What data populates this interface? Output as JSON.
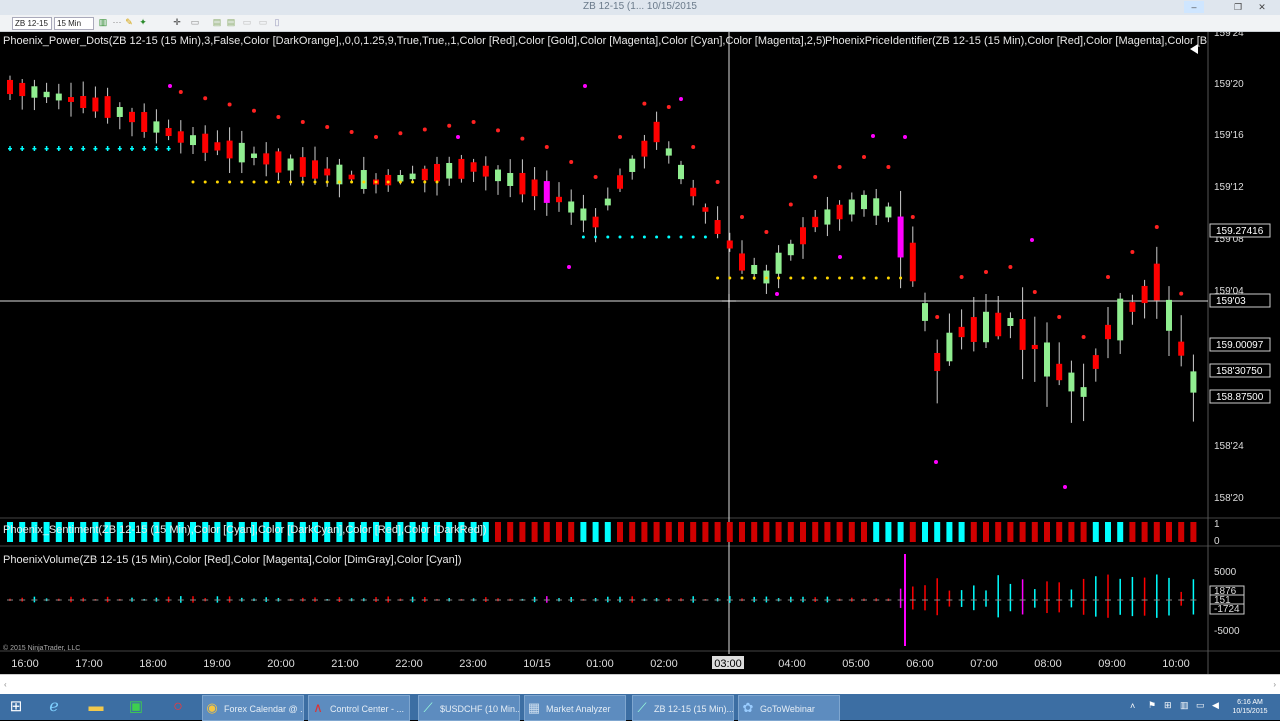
{
  "window": {
    "title": "ZB 12-15 (1... 10/15/2015",
    "minimize": "–",
    "restore": "❐",
    "close": "✕"
  },
  "toolbar": {
    "instrument": "ZB 12-15",
    "interval": "15 Min"
  },
  "indicators": {
    "power_dots": "Phoenix_Power_Dots(ZB 12-15 (15 Min),3,False,Color [DarkOrange],,0,0,1.25,9,True,True,,1,Color [Red],Color [Gold],Color [Magenta],Color [Cyan],Color [Magenta],2,5)",
    "price_identifier": "PhoenixPriceIdentifier(ZB 12-15 (15 Min),Color [Red],Color [Magenta],Color [B",
    "sentiment": "Phoenix_Sentiment(ZB 12-15 (15 Min),Color [Cyan],Color [DarkCyan],Color [Red],Color [DarkRed])",
    "volume": "PhoenixVolume(ZB 12-15 (15 Min),Color [Red],Color [Magenta],Color [DimGray],Color [Cyan])"
  },
  "price_axis": {
    "ticks": [
      "159'24",
      "159'20",
      "159'16",
      "159'12",
      "159'08",
      "159'04",
      "158'28",
      "158'24",
      "158'20"
    ],
    "markers": [
      {
        "label": "159.27416",
        "color": "#ffffff"
      },
      {
        "label": "159'03",
        "color": "#ffffff"
      },
      {
        "label": "159.00097",
        "color": "#ffffff"
      },
      {
        "label": "158'30750",
        "color": "#ffffff"
      },
      {
        "label": "158.87500",
        "color": "#ffffff"
      }
    ]
  },
  "sentiment_axis": {
    "ticks": [
      "1",
      "0"
    ]
  },
  "volume_axis": {
    "ticks": [
      "5000",
      "1876",
      "151",
      "-1724",
      "-5000"
    ]
  },
  "time_axis": {
    "labels": [
      "16:00",
      "17:00",
      "18:00",
      "19:00",
      "20:00",
      "21:00",
      "22:00",
      "23:00",
      "10/15",
      "01:00",
      "02:00",
      "03:00",
      "04:00",
      "05:00",
      "06:00",
      "07:00",
      "08:00",
      "09:00",
      "10:00"
    ],
    "highlight": "03:00"
  },
  "copyright": "© 2015 NinjaTrader, LLC",
  "colors": {
    "up": "#90ee90",
    "down": "#ff0000",
    "magenta": "#ff00ff",
    "cyan": "#00ffff",
    "gold": "#ffd700",
    "red_dot": "#ff2222"
  },
  "taskbar": {
    "items": [
      {
        "label": "Forex Calendar @ ...",
        "icon": "chrome-icon"
      },
      {
        "label": "Control Center - ...",
        "icon": "ninjatrader-icon"
      },
      {
        "label": "$USDCHF (10 Min...",
        "icon": "chart-icon"
      },
      {
        "label": "Market Analyzer",
        "icon": "grid-icon"
      },
      {
        "label": "ZB 12-15 (15 Min)...",
        "icon": "chart-icon"
      },
      {
        "label": "GoToWebinar",
        "icon": "gotowebinar-icon"
      }
    ],
    "time": "6:16 AM",
    "date": "10/15/2015"
  }
}
